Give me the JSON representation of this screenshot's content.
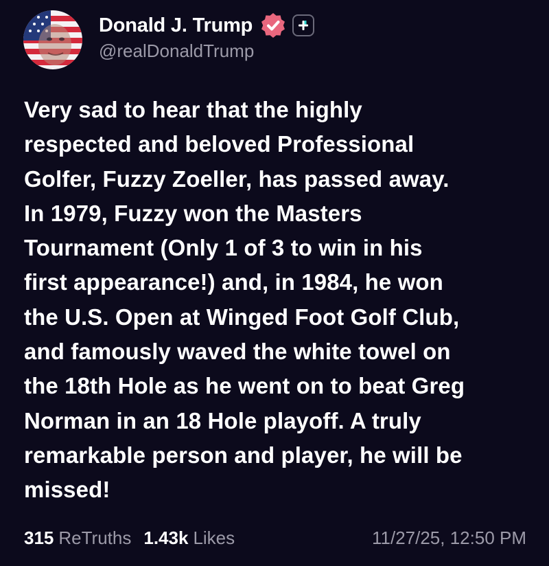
{
  "author": {
    "display_name": "Donald J. Trump",
    "handle": "@realDonaldTrump",
    "verified_badge_color": "#e9677e"
  },
  "post": {
    "text": "Very sad to hear that the highly\nrespected and beloved Professional\nGolfer, Fuzzy Zoeller, has passed away.\nIn 1979, Fuzzy won the Masters\nTournament (Only 1 of 3 to win in his\nfirst appearance!) and, in 1984, he won\nthe U.S. Open at Winged Foot Golf Club,\nand famously waved the white towel on\nthe 18th Hole as he went on to beat Greg\nNorman in an 18 Hole playoff. A truly\nremarkable person and player, he will be\nmissed!"
  },
  "stats": {
    "retruths_count": "315",
    "retruths_label": "ReTruths",
    "likes_count": "1.43k",
    "likes_label": "Likes"
  },
  "timestamp": "11/27/25, 12:50 PM",
  "icons": {
    "verified": "verified-badge-icon",
    "plus": "plus-icon"
  },
  "colors": {
    "background": "#0c0a1c",
    "text_primary": "#ffffff",
    "text_secondary": "#9c9aa8",
    "plus_accent": "#2fd6d0"
  }
}
